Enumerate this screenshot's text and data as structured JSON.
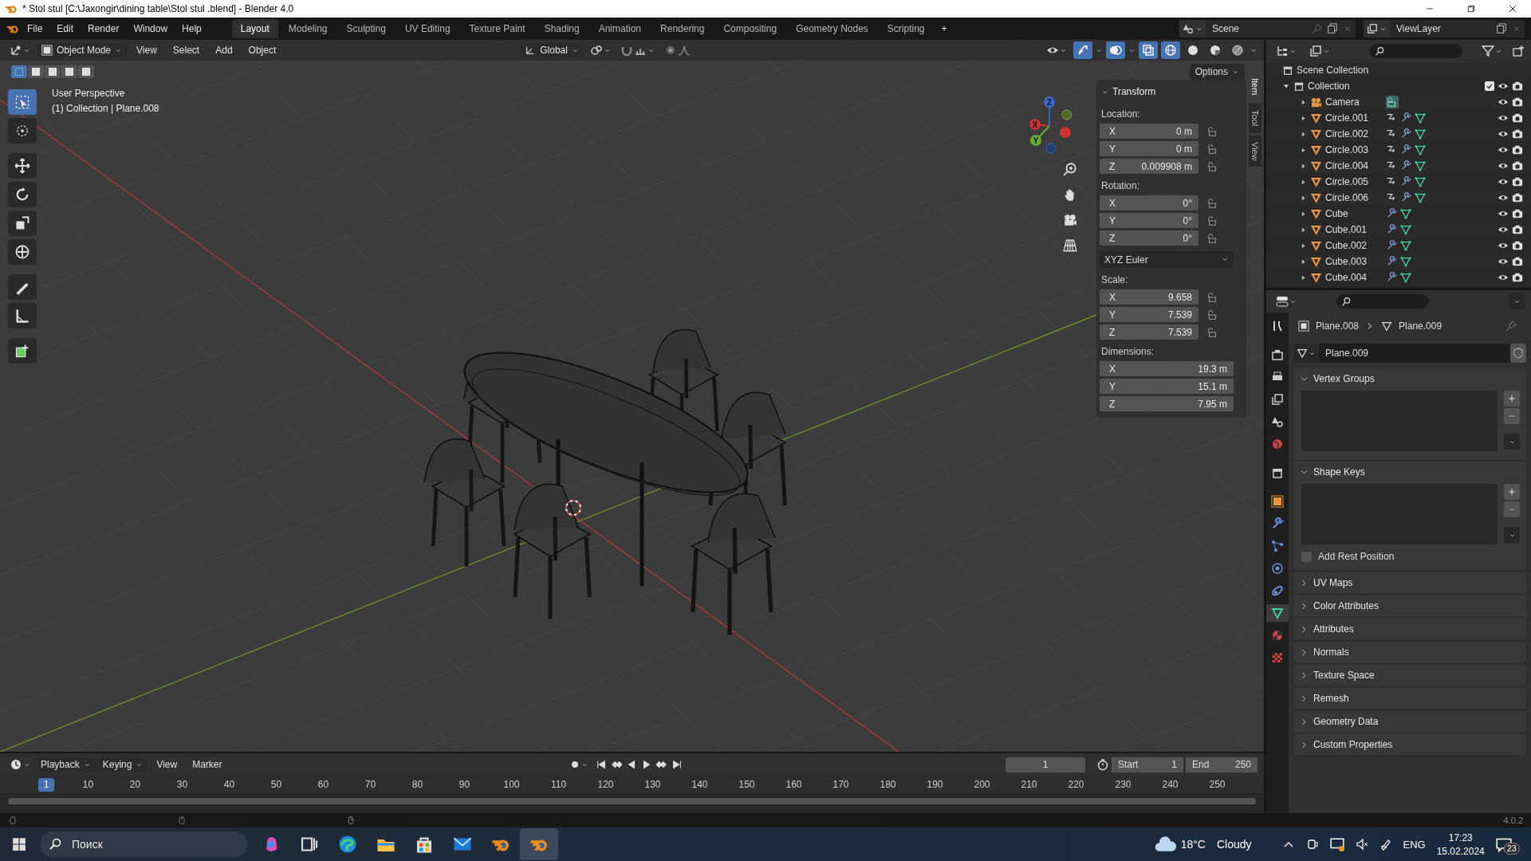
{
  "window": {
    "title": "* Stol stul  [C:\\Jaxongir\\dining table\\Stol stul .blend] - Blender 4.0"
  },
  "menu": [
    "File",
    "Edit",
    "Render",
    "Window",
    "Help"
  ],
  "workspaces": [
    {
      "label": "Layout",
      "selected": true
    },
    {
      "label": "Modeling",
      "selected": false
    },
    {
      "label": "Sculpting",
      "selected": false
    },
    {
      "label": "UV Editing",
      "selected": false
    },
    {
      "label": "Texture Paint",
      "selected": false
    },
    {
      "label": "Shading",
      "selected": false
    },
    {
      "label": "Animation",
      "selected": false
    },
    {
      "label": "Rendering",
      "selected": false
    },
    {
      "label": "Compositing",
      "selected": false
    },
    {
      "label": "Geometry Nodes",
      "selected": false
    },
    {
      "label": "Scripting",
      "selected": false
    }
  ],
  "add_workspace": "+",
  "scene": "Scene",
  "view_layer": "ViewLayer",
  "viewport": {
    "mode": "Object Mode",
    "menus": [
      "View",
      "Select",
      "Add",
      "Object"
    ],
    "orientation": "Global",
    "options": "Options",
    "title": "User Perspective",
    "subtitle": "(1) Collection | Plane.008",
    "gizmo_axes": [
      "X",
      "Y",
      "Z"
    ]
  },
  "sidebar": {
    "tabs": [
      {
        "label": "Item",
        "selected": true
      },
      {
        "label": "Tool",
        "selected": false
      },
      {
        "label": "View",
        "selected": false
      }
    ],
    "panel": "Transform",
    "location": {
      "label": "Location:",
      "fields": [
        {
          "axis": "X",
          "value": "0 m"
        },
        {
          "axis": "Y",
          "value": "0 m"
        },
        {
          "axis": "Z",
          "value": "0.009908 m"
        }
      ]
    },
    "rotation": {
      "label": "Rotation:",
      "fields": [
        {
          "axis": "X",
          "value": "0°"
        },
        {
          "axis": "Y",
          "value": "0°"
        },
        {
          "axis": "Z",
          "value": "0°"
        }
      ]
    },
    "rotation_mode": "XYZ Euler",
    "scale": {
      "label": "Scale:",
      "fields": [
        {
          "axis": "X",
          "value": "9.658"
        },
        {
          "axis": "Y",
          "value": "7.539"
        },
        {
          "axis": "Z",
          "value": "7.539"
        }
      ]
    },
    "dimensions": {
      "label": "Dimensions:",
      "fields": [
        {
          "axis": "X",
          "value": "19.3 m"
        },
        {
          "axis": "Y",
          "value": "15.1 m"
        },
        {
          "axis": "Z",
          "value": "7.95 m"
        }
      ]
    }
  },
  "outliner": {
    "name": "Scene Collection",
    "children": [
      {
        "name": "Collection",
        "expanded": true,
        "checked": true,
        "children": [
          {
            "name": "Camera",
            "kind": "camera",
            "expanded": false,
            "hooked": false
          },
          {
            "name": "Circle.001",
            "kind": "mesh",
            "expanded": false,
            "hooked": true
          },
          {
            "name": "Circle.002",
            "kind": "mesh",
            "expanded": false,
            "hooked": true
          },
          {
            "name": "Circle.003",
            "kind": "mesh",
            "expanded": false,
            "hooked": true
          },
          {
            "name": "Circle.004",
            "kind": "mesh",
            "expanded": false,
            "hooked": true
          },
          {
            "name": "Circle.005",
            "kind": "mesh",
            "expanded": false,
            "hooked": true
          },
          {
            "name": "Circle.006",
            "kind": "mesh",
            "expanded": false,
            "hooked": true
          },
          {
            "name": "Cube",
            "kind": "mesh",
            "expanded": false,
            "hooked": false
          },
          {
            "name": "Cube.001",
            "kind": "mesh",
            "expanded": false,
            "hooked": false
          },
          {
            "name": "Cube.002",
            "kind": "mesh",
            "expanded": false,
            "hooked": false
          },
          {
            "name": "Cube.003",
            "kind": "mesh",
            "expanded": false,
            "hooked": false
          },
          {
            "name": "Cube.004",
            "kind": "mesh",
            "expanded": false,
            "hooked": false
          }
        ]
      }
    ]
  },
  "properties": {
    "tabs": [
      {
        "kind": "tool",
        "selected": false
      },
      {
        "kind": "render",
        "selected": false
      },
      {
        "kind": "output",
        "selected": false
      },
      {
        "kind": "view_layer",
        "selected": false
      },
      {
        "kind": "scene",
        "selected": false
      },
      {
        "kind": "world",
        "selected": false
      },
      {
        "kind": "collection",
        "selected": false
      },
      {
        "kind": "object",
        "selected": false
      },
      {
        "kind": "modifiers",
        "selected": false
      },
      {
        "kind": "particles",
        "selected": false
      },
      {
        "kind": "physics",
        "selected": false
      },
      {
        "kind": "constraints",
        "selected": false
      },
      {
        "kind": "data",
        "selected": true
      },
      {
        "kind": "material",
        "selected": false
      },
      {
        "kind": "texture",
        "selected": false
      }
    ],
    "breadcrumb": [
      "Plane.008",
      "Plane.009"
    ],
    "data_name": "Plane.009",
    "panels": [
      {
        "title": "Vertex Groups",
        "expanded": true
      },
      {
        "title": "Shape Keys",
        "expanded": true,
        "checkbox": {
          "label": "Add Rest Position",
          "checked": false
        }
      },
      {
        "title": "UV Maps",
        "expanded": false
      },
      {
        "title": "Color Attributes",
        "expanded": false
      },
      {
        "title": "Attributes",
        "expanded": false
      },
      {
        "title": "Normals",
        "expanded": false
      },
      {
        "title": "Texture Space",
        "expanded": false
      },
      {
        "title": "Remesh",
        "expanded": false
      },
      {
        "title": "Geometry Data",
        "expanded": false
      },
      {
        "title": "Custom Properties",
        "expanded": false
      }
    ]
  },
  "timeline": {
    "menus": [
      "Playback",
      "Keying",
      "View",
      "Marker"
    ],
    "frame": "1",
    "start_label": "Start",
    "start": "1",
    "end_label": "End",
    "end": "250",
    "current": "1",
    "ticks": [
      "10",
      "20",
      "30",
      "40",
      "50",
      "60",
      "70",
      "80",
      "90",
      "100",
      "110",
      "120",
      "130",
      "140",
      "150",
      "160",
      "170",
      "180",
      "190",
      "200",
      "210",
      "220",
      "230",
      "240",
      "250"
    ]
  },
  "status": {
    "version": "4.0.2"
  },
  "taskbar": {
    "search": {
      "placeholder": "Поиск"
    },
    "apps": [
      {
        "kind": "copilot",
        "selected": false
      },
      {
        "kind": "task-view",
        "selected": false
      },
      {
        "kind": "edge",
        "selected": false
      },
      {
        "kind": "explorer",
        "selected": false
      },
      {
        "kind": "store",
        "selected": false
      },
      {
        "kind": "mail",
        "selected": false
      },
      {
        "kind": "blender",
        "selected": false
      },
      {
        "kind": "blender",
        "selected": true
      }
    ],
    "temperature": "18°C",
    "weather": "Cloudy",
    "language": "ENG",
    "time": "17:23",
    "date": "15.02.2024",
    "notifications": "23"
  }
}
